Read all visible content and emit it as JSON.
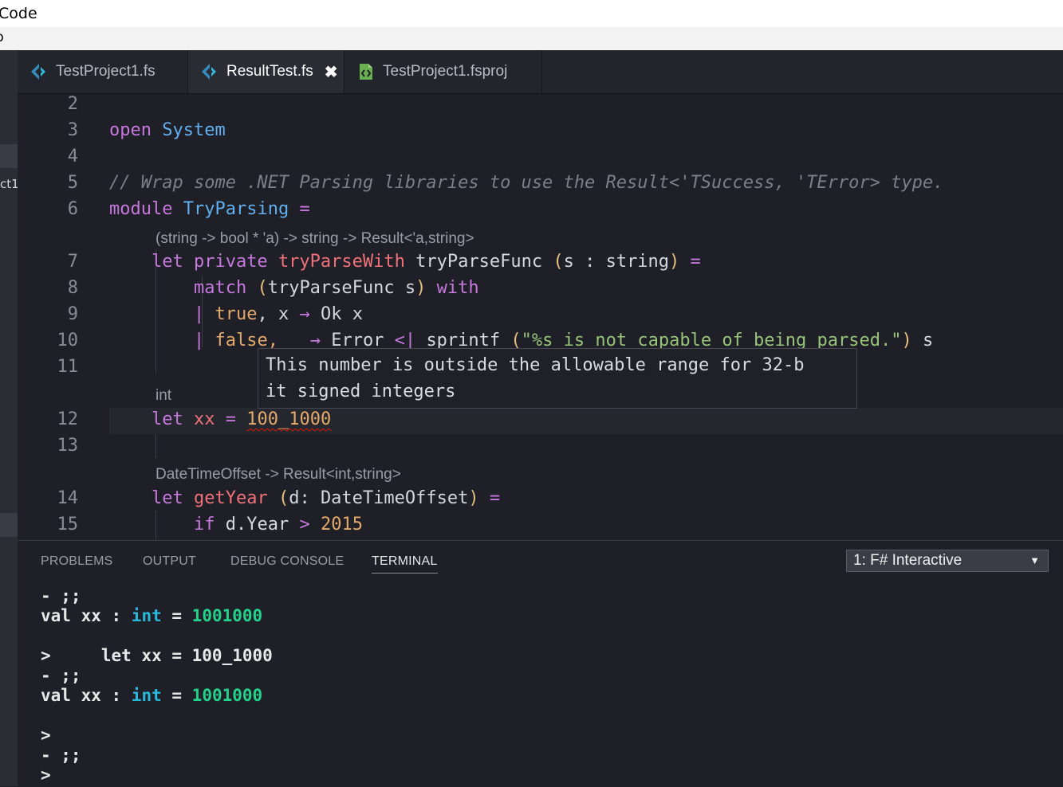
{
  "window": {
    "title": "Code"
  },
  "menu": {
    "partial": "p"
  },
  "sidebar": {
    "partial_label": "ct1"
  },
  "tabs": [
    {
      "label": "TestProject1.fs",
      "icon": "fsharp-icon"
    },
    {
      "label": "ResultTest.fs",
      "icon": "fsharp-icon",
      "close": "✖"
    },
    {
      "label": "TestProject1.fsproj",
      "icon": "fsproj-file-icon"
    }
  ],
  "editor": {
    "line_numbers": [
      "2",
      "3",
      "4",
      "5",
      "6",
      "7",
      "8",
      "9",
      "10",
      "11",
      "12",
      "13",
      "14",
      "15"
    ],
    "lines": {
      "l3_a": "open",
      "l3_b": "System",
      "l5": "// Wrap some .NET Parsing libraries to use the Result<'TSuccess, 'TError> type.",
      "l6_a": "module",
      "l6_b": "TryParsing",
      "l6_c": "=",
      "l7_a": "let private",
      "l7_b": "tryParseWith",
      "l7_c": "tryParseFunc",
      "l7_d": "(",
      "l7_e": "s : string",
      "l7_f": ")",
      "l7_g": "=",
      "l8_a": "match",
      "l8_b": "(",
      "l8_c": "tryParseFunc s",
      "l8_d": ")",
      "l8_e": "with",
      "l9_a": "|",
      "l9_b": "true",
      "l9_c": ", x",
      "l9_d": "→",
      "l9_e": "Ok x",
      "l10_a": "|",
      "l10_b": "false,",
      "l10_c": "→",
      "l10_d": "Error",
      "l10_e": "<|",
      "l10_f": "sprintf",
      "l10_g": "(",
      "l10_h": "\"%s is not capable of being parsed.\"",
      "l10_i": ")",
      "l10_j": "s",
      "l12_a": "let",
      "l12_b": "xx",
      "l12_c": "=",
      "l12_d": "100_1000",
      "l14_a": "let",
      "l14_b": "getYear",
      "l14_c": "(",
      "l14_d": "d: DateTimeOffset",
      "l14_e": ")",
      "l14_f": "=",
      "l15_a": "if",
      "l15_b": "d.Year",
      "l15_c": ">",
      "l15_d": "2015"
    },
    "codelens": {
      "try_parse": "(string -> bool * 'a) -> string -> Result<'a,string>",
      "xx": "int",
      "get_year": "DateTimeOffset -> Result<int,string>"
    },
    "hover": {
      "line1": "This number is outside the allowable range for 32-b",
      "line2": "it signed integers"
    }
  },
  "panel": {
    "tabs": [
      "PROBLEMS",
      "OUTPUT",
      "DEBUG CONSOLE",
      "TERMINAL"
    ],
    "terminal_select": "1: F# Interactive",
    "select_arrow": "▼",
    "terminal": {
      "t1": "- ;;",
      "t2a": "val xx : ",
      "t2b": "int",
      "t2c": " = ",
      "t2d": "1001000",
      "t3": ">     let xx = 100_1000",
      "t4": "- ;;",
      "t5a": "val xx : ",
      "t5b": "int",
      "t5c": " = ",
      "t5d": "1001000",
      "t6": ">",
      "t7": "- ;;",
      "t8": ">"
    }
  }
}
